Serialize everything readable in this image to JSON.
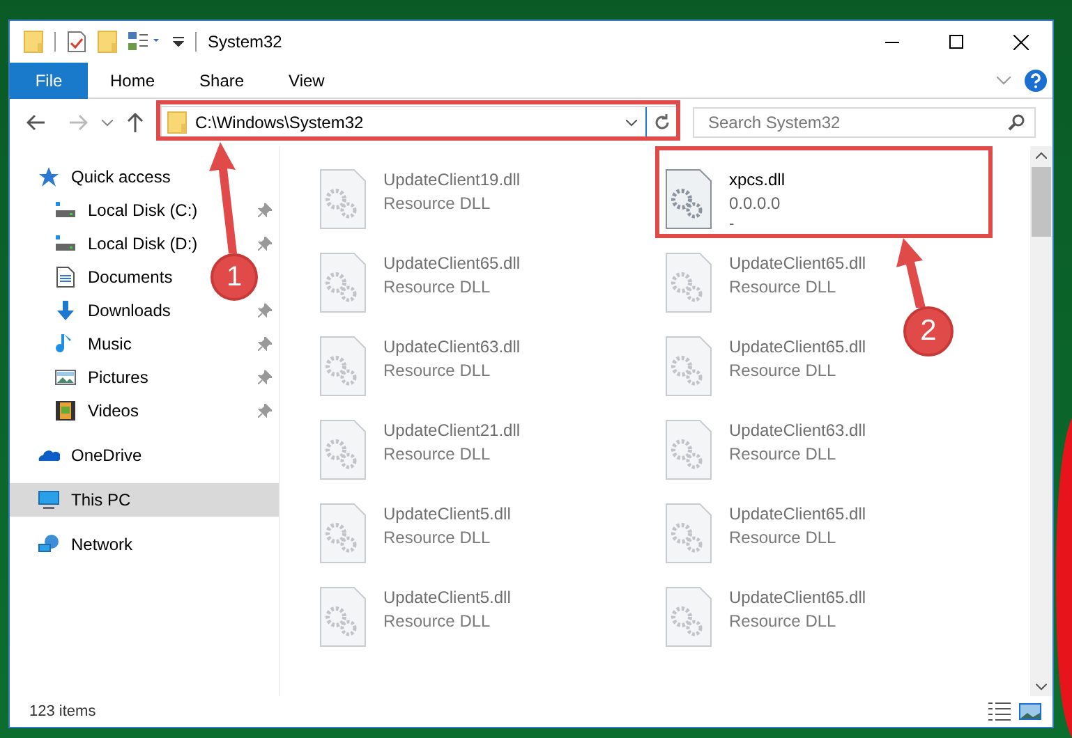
{
  "window": {
    "title": "System32"
  },
  "ribbon_tabs": [
    {
      "label": "File",
      "selected": true
    },
    {
      "label": "Home",
      "selected": false
    },
    {
      "label": "Share",
      "selected": false
    },
    {
      "label": "View",
      "selected": false
    }
  ],
  "address": {
    "value": "C:\\Windows\\System32"
  },
  "search": {
    "placeholder": "Search System32"
  },
  "sidebar": {
    "items": [
      {
        "label": "Quick access",
        "kind": "star",
        "selected": false,
        "children": [
          {
            "label": "Local Disk (C:)",
            "kind": "drive",
            "pinned": true
          },
          {
            "label": "Local Disk (D:)",
            "kind": "drive",
            "pinned": true
          },
          {
            "label": "Documents",
            "kind": "document"
          },
          {
            "label": "Downloads",
            "kind": "download",
            "pinned": true
          },
          {
            "label": "Music",
            "kind": "music",
            "pinned": true
          },
          {
            "label": "Pictures",
            "kind": "pictures",
            "pinned": true
          },
          {
            "label": "Videos",
            "kind": "videos",
            "pinned": true
          }
        ]
      },
      {
        "label": "OneDrive",
        "kind": "cloud",
        "selected": false
      },
      {
        "label": "This PC",
        "kind": "computer",
        "selected": true
      },
      {
        "label": "Network",
        "kind": "network",
        "selected": false
      }
    ]
  },
  "files": [
    {
      "name": "UpdateClient19.dll",
      "type": "Resource DLL",
      "blurred": true
    },
    {
      "name": "xpcs.dll",
      "type": "0.0.0.0",
      "extra": "-",
      "blurred": false
    },
    {
      "name": "UpdateClient65.dll",
      "type": "Resource DLL",
      "blurred": true
    },
    {
      "name": "UpdateClient65.dll",
      "type": "Resource DLL",
      "blurred": true
    },
    {
      "name": "UpdateClient63.dll",
      "type": "Resource DLL",
      "blurred": true
    },
    {
      "name": "UpdateClient65.dll",
      "type": "Resource DLL",
      "blurred": true
    },
    {
      "name": "UpdateClient21.dll",
      "type": "Resource DLL",
      "blurred": true
    },
    {
      "name": "UpdateClient63.dll",
      "type": "Resource DLL",
      "blurred": true
    },
    {
      "name": "UpdateClient5.dll",
      "type": "Resource DLL",
      "blurred": true
    },
    {
      "name": "UpdateClient65.dll",
      "type": "Resource DLL",
      "blurred": true
    },
    {
      "name": "UpdateClient5.dll",
      "type": "Resource DLL",
      "blurred": true
    },
    {
      "name": "UpdateClient65.dll",
      "type": "Resource DLL",
      "blurred": true
    }
  ],
  "status_bar": {
    "count": "123 items"
  },
  "annotations": [
    {
      "number": "1"
    },
    {
      "number": "2"
    }
  ]
}
